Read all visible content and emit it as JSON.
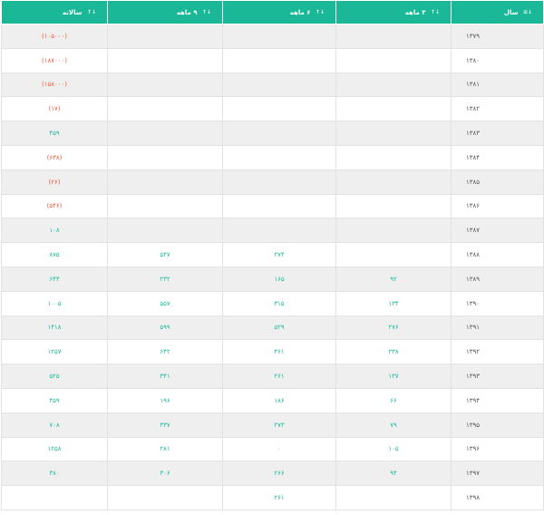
{
  "table": {
    "headers": [
      {
        "label": "سال",
        "sort": "↓≡"
      },
      {
        "label": "۳ ماهه",
        "sort": "↓↑"
      },
      {
        "label": "۶ ماهه",
        "sort": "↓↑"
      },
      {
        "label": "۹ ماهه",
        "sort": "↓↑"
      },
      {
        "label": "سالانه",
        "sort": "↓↑"
      }
    ],
    "rows": [
      [
        "۱۳۷۹",
        "",
        "",
        "",
        "(۱۰۵۰۰۰)"
      ],
      [
        "۱۳۸۰",
        "",
        "",
        "",
        "(۱۸۷۰۰۰)"
      ],
      [
        "۱۳۸۱",
        "",
        "",
        "",
        "(۱۵۸۰۰۰)"
      ],
      [
        "۱۳۸۲",
        "",
        "",
        "",
        "(۱۷)"
      ],
      [
        "۱۳۸۳",
        "",
        "",
        "",
        "۴۵۹"
      ],
      [
        "۱۳۸۴",
        "",
        "",
        "",
        "(۶۳۸)"
      ],
      [
        "۱۳۸۵",
        "",
        "",
        "",
        "(۲۶)"
      ],
      [
        "۱۳۸۶",
        "",
        "",
        "",
        "(۵۴۶)"
      ],
      [
        "۱۳۸۷",
        "",
        "",
        "",
        "۱۰۸"
      ],
      [
        "۱۳۸۸",
        "",
        "۲۷۴",
        "۵۴۷",
        "۸۷۵"
      ],
      [
        "۱۳۸۹",
        "۹۲",
        "۱۶۵",
        "۲۳۲",
        "۶۴۳"
      ],
      [
        "۱۳۹۰",
        "۱۳۴",
        "۳۱۵",
        "۵۵۷",
        "۱۰۰۵"
      ],
      [
        "۱۳۹۱",
        "۲۷۶",
        "۵۲۹",
        "۵۹۹",
        "۱۴۱۸"
      ],
      [
        "۱۳۹۲",
        "۲۳۸",
        "۴۶۱",
        "۶۴۲",
        "۱۲۵۷"
      ],
      [
        "۱۳۹۳",
        "۱۳۷",
        "۲۶۱",
        "۳۴۱",
        "۵۲۵"
      ],
      [
        "۱۳۹۴",
        "۶۶",
        "۱۸۶",
        "۱۹۶",
        "۴۵۹"
      ],
      [
        "۱۳۹۵",
        "۷۹",
        "۲۷۳",
        "۳۳۷",
        "۷۰۸"
      ],
      [
        "۱۳۹۶",
        "۱۰۵",
        "۰",
        "۲۸۱",
        "۱۲۵۸"
      ],
      [
        "۱۳۹۷",
        "۹۴",
        "۲۶۶",
        "۳۰۶",
        "۳۸۰"
      ],
      [
        "۱۳۹۸",
        "",
        "۲۶۱",
        "",
        ""
      ]
    ],
    "colors": {
      "header_bg": "#1bb897",
      "positive": "#1bb897",
      "negative": "#ef5a3c",
      "stripe": "#efefef"
    }
  }
}
